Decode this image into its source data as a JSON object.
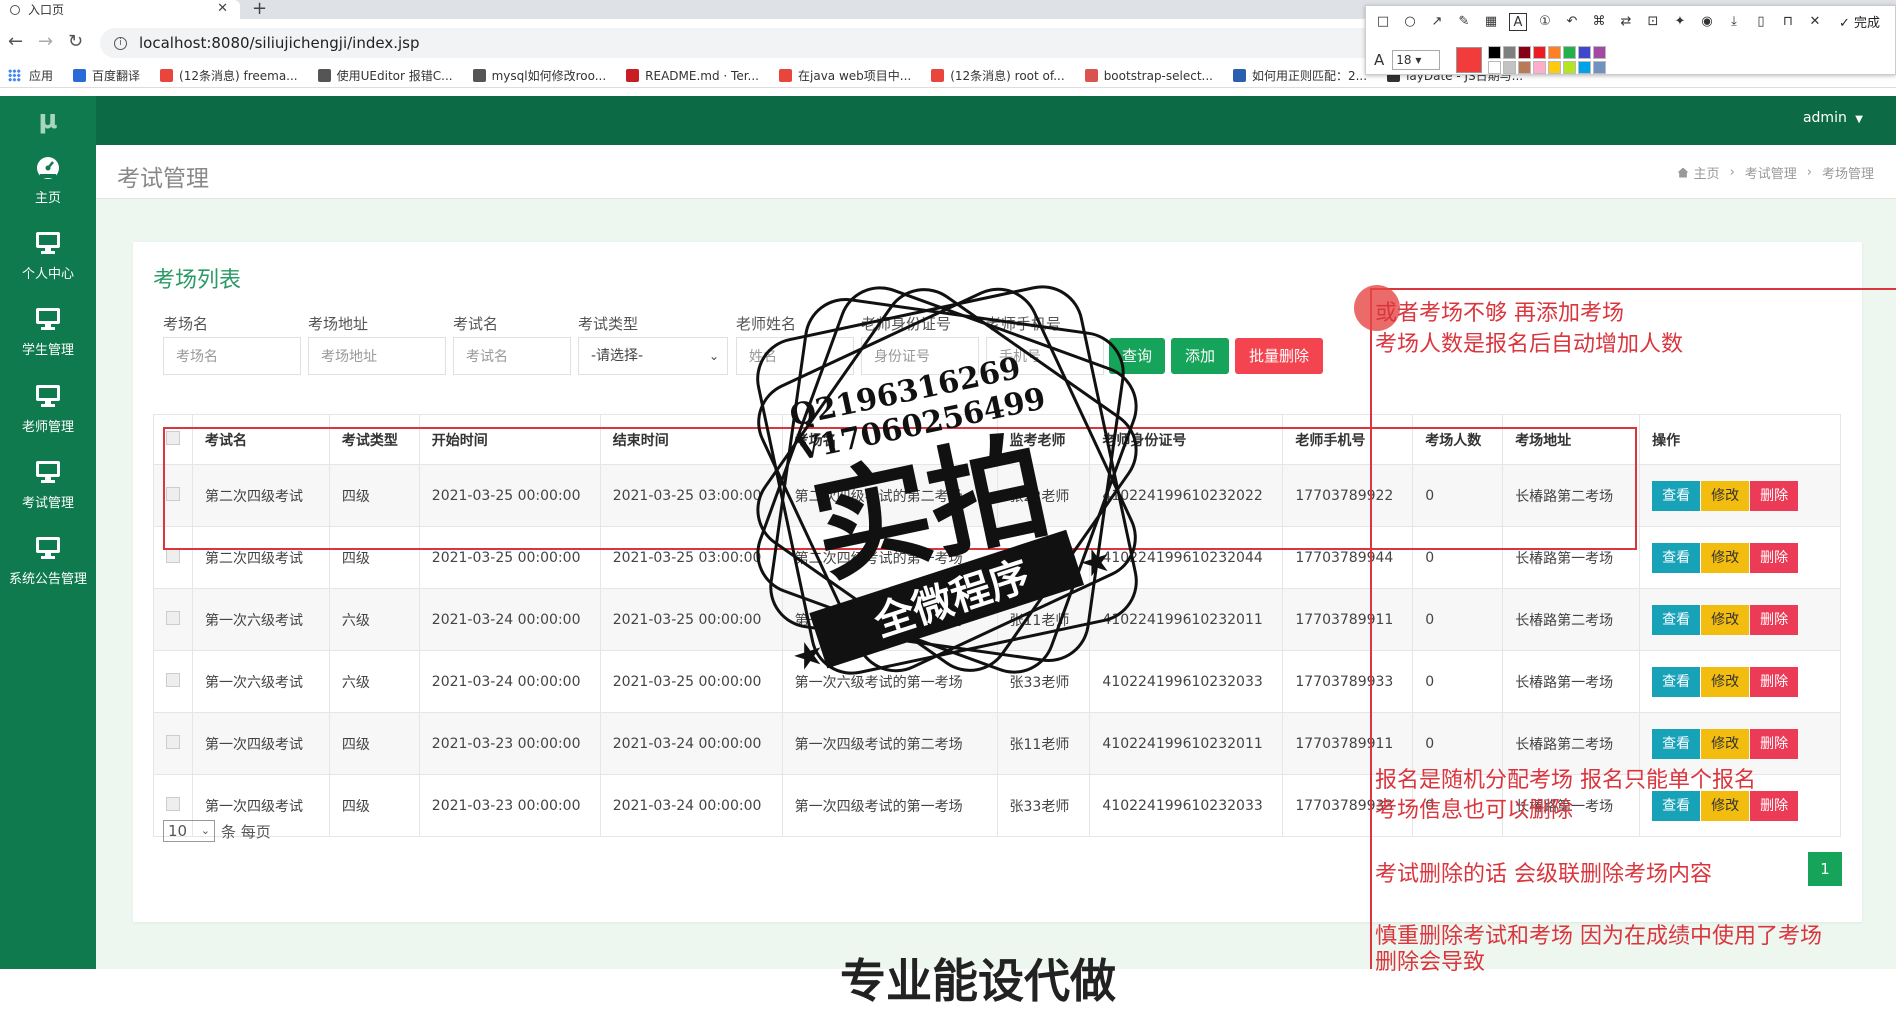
{
  "browser": {
    "tab_title": "入口页",
    "url": "localhost:8080/siliujichengji/index.jsp",
    "bookmarks": [
      {
        "label": "应用",
        "color": "#4285f4"
      },
      {
        "label": "百度翻译",
        "color": "#2a6bd8"
      },
      {
        "label": "(12条消息) freema...",
        "color": "#e8453c"
      },
      {
        "label": "使用UEditor 报错C...",
        "color": "#555555"
      },
      {
        "label": "mysql如何修改roo...",
        "color": "#555555"
      },
      {
        "label": "README.md · Ter...",
        "color": "#c71d23"
      },
      {
        "label": "在java web项目中...",
        "color": "#e8453c"
      },
      {
        "label": "(12条消息) root of...",
        "color": "#e8453c"
      },
      {
        "label": "bootstrap-select...",
        "color": "#d9534f"
      },
      {
        "label": "如何用正则匹配：2...",
        "color": "#2a5fb0"
      },
      {
        "label": "layDate - JS日期与...",
        "color": "#333333"
      }
    ]
  },
  "snip_toolbar": {
    "done_label": "完成",
    "font_size": "18",
    "current_color": "#f23c3c",
    "palette": [
      "#000000",
      "#7f7f7f",
      "#880015",
      "#ed1c24",
      "#ff7f27",
      "#22b14c",
      "#3f48cc",
      "#a349a4",
      "#ffffff",
      "#c3c3c3",
      "#b97a57",
      "#ffaec9",
      "#ffc90e",
      "#b5e61d",
      "#00a2e8",
      "#7092be"
    ]
  },
  "app": {
    "brand": "μ",
    "user": "admin",
    "sidebar": [
      {
        "label": "主页",
        "icon": "dashboard-icon"
      },
      {
        "label": "个人中心",
        "icon": "monitor-icon"
      },
      {
        "label": "学生管理",
        "icon": "monitor-icon"
      },
      {
        "label": "老师管理",
        "icon": "monitor-icon"
      },
      {
        "label": "考试管理",
        "icon": "monitor-icon"
      },
      {
        "label": "系统公告管理",
        "icon": "monitor-icon"
      }
    ],
    "page_title": "考试管理",
    "breadcrumb": [
      "主页",
      "考试管理",
      "考场管理"
    ]
  },
  "panel": {
    "title": "考场列表",
    "filters": {
      "room_name": {
        "label": "考场名",
        "placeholder": "考场名"
      },
      "room_address": {
        "label": "考场地址",
        "placeholder": "考场地址"
      },
      "exam_name": {
        "label": "考试名",
        "placeholder": "考试名"
      },
      "exam_type": {
        "label": "考试类型",
        "value": "-请选择-"
      },
      "teacher_name": {
        "label": "老师姓名",
        "placeholder": "姓名"
      },
      "teacher_id": {
        "label": "老师身份证号",
        "placeholder": "身份证号"
      },
      "teacher_phone": {
        "label": "老师手机号",
        "placeholder": "手机号"
      }
    },
    "buttons": {
      "search": "查询",
      "add": "添加",
      "batch_delete": "批量删除"
    },
    "columns": [
      "考试名",
      "考试类型",
      "开始时间",
      "结束时间",
      "考场名",
      "监考老师",
      "老师身份证号",
      "老师手机号",
      "考场人数",
      "考场地址",
      "操作"
    ],
    "rows": [
      [
        "第二次四级考试",
        "四级",
        "2021-03-25 00:00:00",
        "2021-03-25 03:00:00",
        "第二次四级考试的第二考场",
        "张22老师",
        "410224199610232022",
        "17703789922",
        "0",
        "长椿路第二考场"
      ],
      [
        "第二次四级考试",
        "四级",
        "2021-03-25 00:00:00",
        "2021-03-25 03:00:00",
        "第二次四级考试的第一考场",
        "张44老师",
        "410224199610232044",
        "17703789944",
        "0",
        "长椿路第一考场"
      ],
      [
        "第一次六级考试",
        "六级",
        "2021-03-24 00:00:00",
        "2021-03-25 00:00:00",
        "第一次六级考试的第二考场",
        "张11老师",
        "410224199610232011",
        "17703789911",
        "0",
        "长椿路第二考场"
      ],
      [
        "第一次六级考试",
        "六级",
        "2021-03-24 00:00:00",
        "2021-03-25 00:00:00",
        "第一次六级考试的第一考场",
        "张33老师",
        "410224199610232033",
        "17703789933",
        "0",
        "长椿路第一考场"
      ],
      [
        "第一次四级考试",
        "四级",
        "2021-03-23 00:00:00",
        "2021-03-24 00:00:00",
        "第一次四级考试的第二考场",
        "张11老师",
        "410224199610232011",
        "17703789911",
        "0",
        "长椿路第二考场"
      ],
      [
        "第一次四级考试",
        "四级",
        "2021-03-23 00:00:00",
        "2021-03-24 00:00:00",
        "第一次四级考试的第一考场",
        "张33老师",
        "410224199610232033",
        "17703789933",
        "0",
        "长椿路第一考场"
      ]
    ],
    "row_actions": {
      "view": "查看",
      "edit": "修改",
      "delete": "删除"
    },
    "page_size": "10",
    "page_size_suffix": "条 每页",
    "current_page": "1"
  },
  "annotations": {
    "note1_line1": "或者考场不够 再添加考场",
    "note1_line2": "考场人数是报名后自动增加人数",
    "note2_line1": "报名是随机分配考场 报名只能单个报名",
    "note2_line2": "考场信息也可以删除",
    "note3": "考试删除的话  会级联删除考场内容",
    "note4_line1": "慎重删除考试和考场  因为在成绩中使用了考场",
    "note4_line2": "删除会导致",
    "bottom_text": "专业能设代做"
  },
  "watermark": {
    "contact1": "Q2196316269",
    "contact2": "V17060256499",
    "big": "实拍",
    "banner": "全微程序"
  }
}
